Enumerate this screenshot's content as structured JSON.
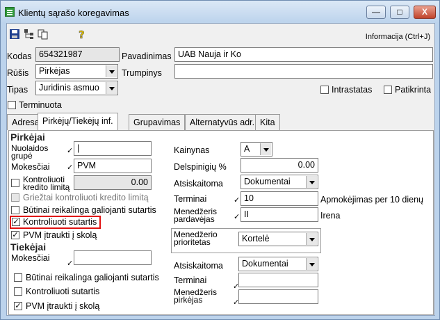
{
  "window": {
    "title": "Klientų sąrašo koregavimas",
    "min_glyph": "—",
    "max_glyph": "□",
    "close_glyph": "X"
  },
  "toolbar": {
    "info_label": "Informacija (Ctrl+J)"
  },
  "header": {
    "kodas_label": "Kodas",
    "kodas_value": "654321987",
    "pavadinimas_label": "Pavadinimas",
    "pavadinimas_value": "UAB Nauja ir Ko",
    "rusis_label": "Rūšis",
    "rusis_value": "Pirkėjas",
    "trumpinys_label": "Trumpinys",
    "trumpinys_value": "",
    "tipas_label": "Tipas",
    "tipas_value": "Juridinis asmuo",
    "intrastatas_label": "Intrastatas",
    "patikrinta_label": "Patikrinta",
    "terminuota_label": "Terminuota"
  },
  "tabs": [
    "Adresas",
    "Pirkėjų/Tiekėjų inf.",
    "Grupavimas",
    "Alternatyvūs adr.",
    "Kita"
  ],
  "pirkejai": {
    "title": "Pirkėjai",
    "nuolaidos_label": "Nuolaidos grupė",
    "mokesciai_label": "Mokesčiai",
    "mokesciai_value": "PVM",
    "kontroliuoti_limita_label": "Kontroliuoti kredito limitą",
    "kredito_value": "0.00",
    "grieztai_label": "Griežtai kontroliuoti kredito limitą",
    "butinai_label": "Būtinai reikalinga galiojanti sutartis",
    "kontroliuoti_sutartis_label": "Kontroliuoti sutartis",
    "pvm_label": "PVM įtraukti į skolą",
    "kainynas_label": "Kainynas",
    "kainynas_value": "A",
    "delspinigiu_label": "Delspinigių %",
    "delspinigiu_value": "0.00",
    "atsiskaitoma_label": "Atsiskaitoma",
    "atsiskaitoma_value": "Dokumentai",
    "terminai_label": "Terminai",
    "terminai_value": "10",
    "terminai_note": "Apmokėjimas per 10 dienų",
    "menedzeris_label": "Menedžeris pardavėjas",
    "menedzeris_value": "II",
    "menedzeris_name": "Irena",
    "menedzerio_prioritetas_label": "Menedžerio prioritetas",
    "menedzerio_prioritetas_value": "Kortelė"
  },
  "tiekejai": {
    "title": "Tiekėjai",
    "mokesciai_label": "Mokesčiai",
    "butinai_label": "Būtinai reikalinga galiojanti sutartis",
    "kontroliuoti_sutartis_label": "Kontroliuoti sutartis",
    "pvm_label": "PVM įtraukti į skolą",
    "atsiskaitoma_label": "Atsiskaitoma",
    "atsiskaitoma_value": "Dokumentai",
    "terminai_label": "Terminai",
    "menedzeris_label": "Menedžeris pirkėjas"
  }
}
